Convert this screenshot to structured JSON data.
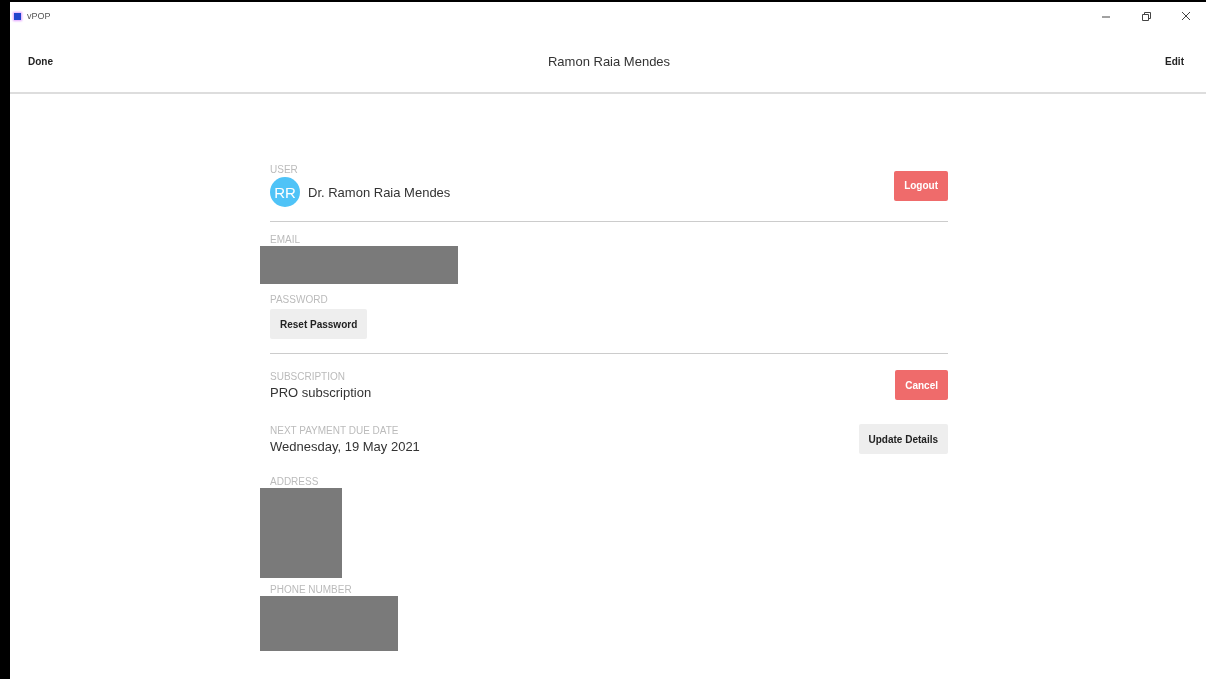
{
  "window": {
    "title": "vPOP"
  },
  "header": {
    "left_button": "Done",
    "title": "Ramon Raia Mendes",
    "right_button": "Edit"
  },
  "sections": [
    {
      "kind": "user",
      "label": "USER",
      "initials": "RR",
      "value": "Dr. Ramon Raia Mendes",
      "button": {
        "label": "Logout",
        "kind": "destructive"
      }
    },
    {
      "kind": "divider"
    },
    {
      "kind": "redacted",
      "label": "EMAIL"
    },
    {
      "kind": "action",
      "label": "PASSWORD",
      "button": {
        "label": "Reset Password",
        "kind": "secondary"
      }
    },
    {
      "kind": "divider"
    },
    {
      "kind": "text",
      "label": "SUBSCRIPTION",
      "value": "PRO subscription",
      "button": {
        "label": "Cancel",
        "kind": "destructive"
      }
    },
    {
      "kind": "text",
      "label": "NEXT PAYMENT DUE DATE",
      "value": "Wednesday, 19 May 2021",
      "button": {
        "label": "Update Details",
        "kind": "secondary"
      }
    },
    {
      "kind": "redacted",
      "label": "ADDRESS"
    },
    {
      "kind": "redacted",
      "label": "PHONE NUMBER"
    }
  ]
}
